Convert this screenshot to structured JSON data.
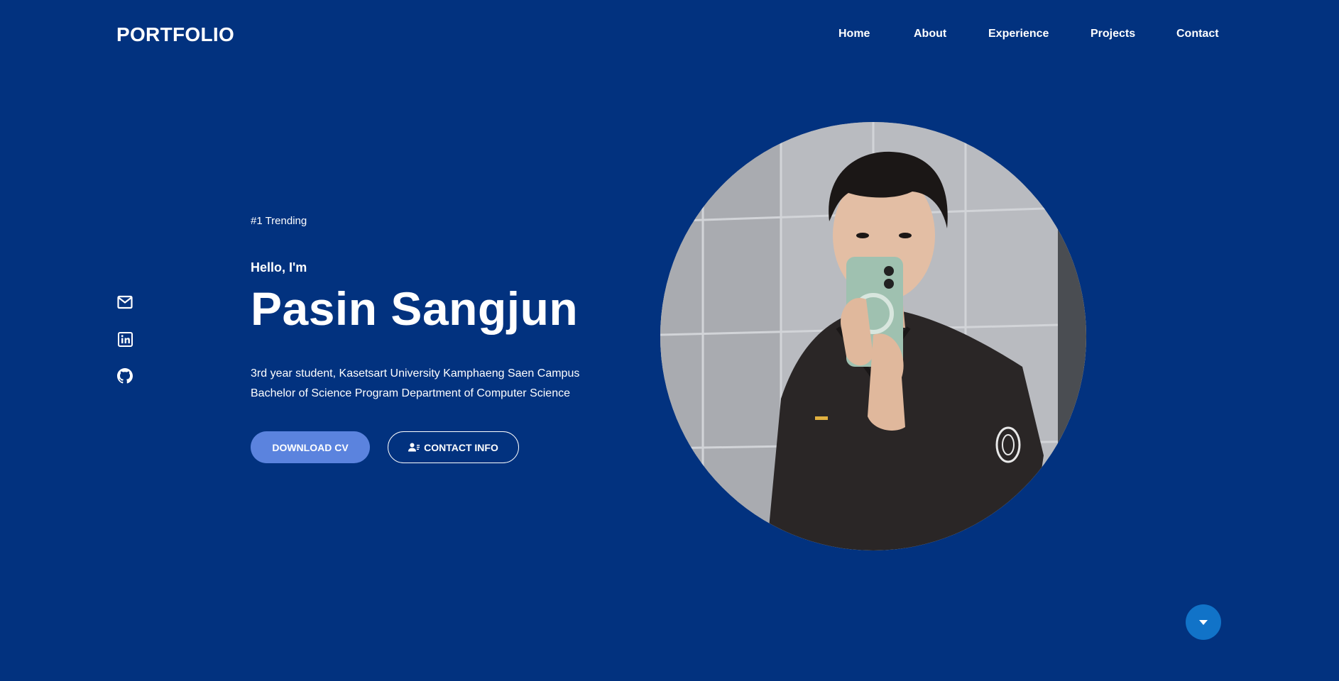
{
  "header": {
    "logo": "PORTFOLIO",
    "nav": [
      "Home",
      "About",
      "Experience",
      "Projects",
      "Contact"
    ]
  },
  "socials": [
    {
      "icon": "mail-icon"
    },
    {
      "icon": "linkedin-icon"
    },
    {
      "icon": "github-icon"
    }
  ],
  "hero": {
    "tag": "#1 Trending",
    "greeting": "Hello, I'm",
    "name": "Pasin Sangjun",
    "description_line1": "3rd year student, Kasetsart University Kamphaeng Saen Campus",
    "description_line2": "Bachelor of Science Program Department of Computer Science",
    "download_label": "DOWNLOAD CV",
    "contact_label": "CONTACT INFO"
  },
  "profile_photo": {
    "alt": "profile photo"
  },
  "scroll_button": {
    "icon": "chevron-down-icon"
  },
  "colors": {
    "background": "#02327f",
    "primary_button": "#5b83de",
    "scroll_button": "#1173c8",
    "text": "#ffffff"
  }
}
